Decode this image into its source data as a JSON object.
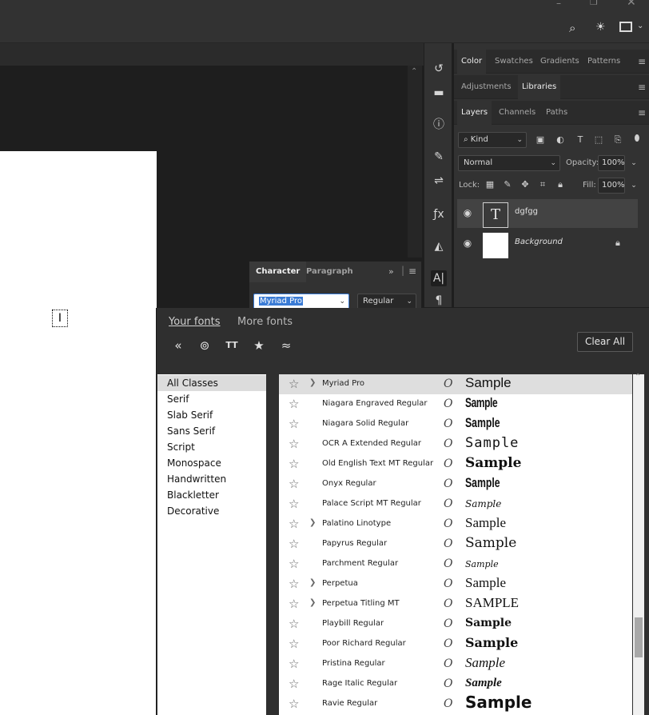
{
  "window": {
    "minimize_icon": "minimize-icon",
    "restore_icon": "restore-icon",
    "close_icon": "close-icon"
  },
  "toolbar": {
    "search_icon": "search-icon",
    "bulb_icon": "lightbulb-icon",
    "workspace_icon": "workspace-icon"
  },
  "panels": {
    "color_group": {
      "tabs": [
        "Color",
        "Swatches",
        "Gradients",
        "Patterns"
      ],
      "active": "Color"
    },
    "adjust_group": {
      "tabs": [
        "Adjustments",
        "Libraries"
      ],
      "active": "Libraries"
    },
    "layers_group": {
      "tabs": [
        "Layers",
        "Channels",
        "Paths"
      ],
      "active": "Layers"
    }
  },
  "layers": {
    "filter_kind": "Kind",
    "blend_mode": "Normal",
    "opacity_label": "Opacity:",
    "opacity_value": "100%",
    "lock_label": "Lock:",
    "fill_label": "Fill:",
    "fill_value": "100%",
    "items": [
      {
        "name": "dgfgg",
        "type": "text",
        "thumb_glyph": "T",
        "selected": true
      },
      {
        "name": "Background",
        "type": "raster",
        "locked": true,
        "selected": false
      }
    ]
  },
  "character": {
    "tabs": [
      "Character",
      "Paragraph"
    ],
    "active": "Character",
    "font_family": "Myriad Pro",
    "font_style": "Regular"
  },
  "font_picker": {
    "tabs": [
      "Your fonts",
      "More fonts"
    ],
    "active_tab": "Your fonts",
    "clear_all": "Clear All",
    "classes": [
      "All Classes",
      "Serif",
      "Slab Serif",
      "Sans Serif",
      "Script",
      "Monospace",
      "Handwritten",
      "Blackletter",
      "Decorative"
    ],
    "selected_class": "All Classes",
    "type_glyph": "O",
    "fonts": [
      {
        "name": "Myriad Pro",
        "family": true,
        "sample": "Sample",
        "selected": true
      },
      {
        "name": "Niagara Engraved Regular",
        "family": false,
        "sample": "Sample"
      },
      {
        "name": "Niagara Solid Regular",
        "family": false,
        "sample": "Sample"
      },
      {
        "name": "OCR A Extended Regular",
        "family": false,
        "sample": "Sample"
      },
      {
        "name": "Old English Text MT Regular",
        "family": false,
        "sample": "Sample"
      },
      {
        "name": "Onyx Regular",
        "family": false,
        "sample": "Sample"
      },
      {
        "name": "Palace Script MT Regular",
        "family": false,
        "sample": "Sample"
      },
      {
        "name": "Palatino Linotype",
        "family": true,
        "sample": "Sample"
      },
      {
        "name": "Papyrus Regular",
        "family": false,
        "sample": "Sample"
      },
      {
        "name": "Parchment Regular",
        "family": false,
        "sample": "Sample"
      },
      {
        "name": "Perpetua",
        "family": true,
        "sample": "Sample"
      },
      {
        "name": "Perpetua Titling MT",
        "family": true,
        "sample": "SAMPLE"
      },
      {
        "name": "Playbill Regular",
        "family": false,
        "sample": "Sample"
      },
      {
        "name": "Poor Richard Regular",
        "family": false,
        "sample": "Sample"
      },
      {
        "name": "Pristina Regular",
        "family": false,
        "sample": "Sample"
      },
      {
        "name": "Rage Italic Regular",
        "family": false,
        "sample": "Sample"
      },
      {
        "name": "Ravie Regular",
        "family": false,
        "sample": "Sample"
      }
    ]
  }
}
